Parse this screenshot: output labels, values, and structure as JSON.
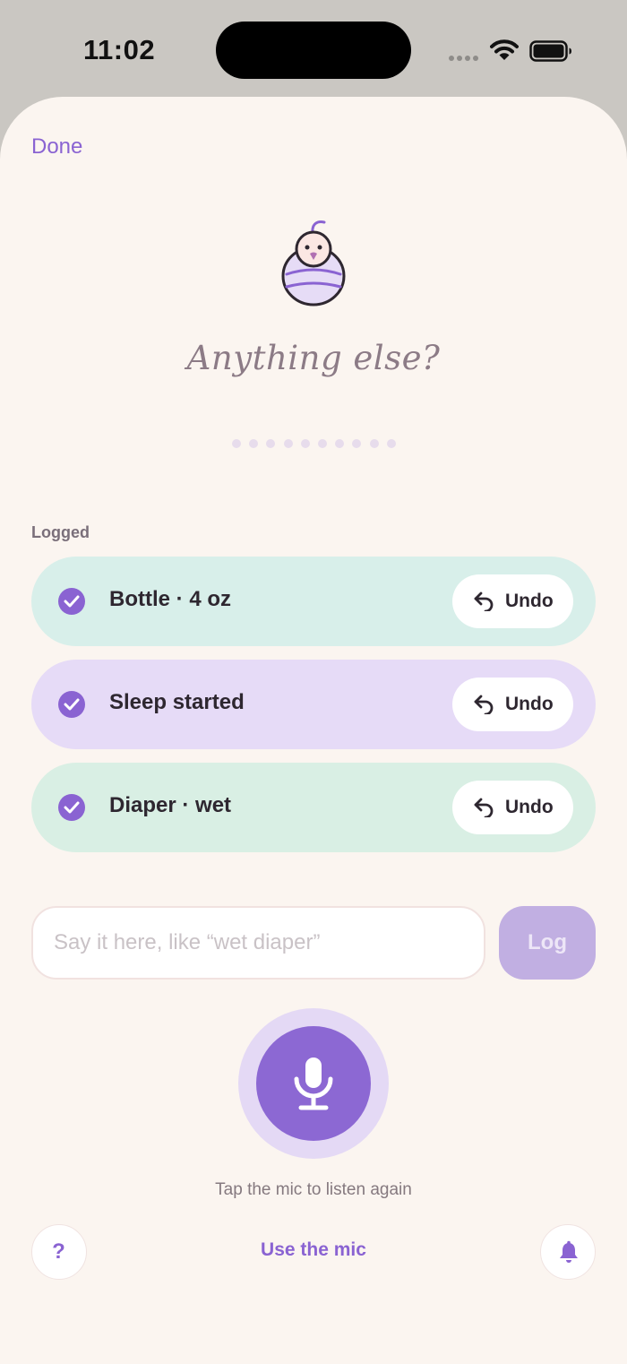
{
  "status_bar": {
    "time": "11:02",
    "icons": [
      "signal-dots-icon",
      "wifi-icon",
      "battery-icon"
    ]
  },
  "header": {
    "done_label": "Done"
  },
  "hero": {
    "mascot_icon": "swaddled-baby-icon",
    "headline": "Anything else?",
    "progress_dot_count": 10
  },
  "logged": {
    "section_label": "Logged",
    "items": [
      {
        "label": "Bottle · 4 oz",
        "undo_label": "Undo",
        "color": "#d8efea"
      },
      {
        "label": "Sleep started",
        "undo_label": "Undo",
        "color": "#e6dbf7"
      },
      {
        "label": "Diaper · wet",
        "undo_label": "Undo",
        "color": "#d9efe4"
      }
    ]
  },
  "composer": {
    "placeholder": "Say it here, like “wet diaper”",
    "value": "",
    "log_label": "Log"
  },
  "mic": {
    "icon": "microphone-icon",
    "hint": "Tap the mic to listen again"
  },
  "footer": {
    "help_glyph": "?",
    "use_mic_label": "Use the mic",
    "bell_icon": "bell-icon"
  },
  "colors": {
    "accent": "#8a63d2",
    "background": "#fbf5f0",
    "log_button_disabled": "#c1afe2"
  }
}
